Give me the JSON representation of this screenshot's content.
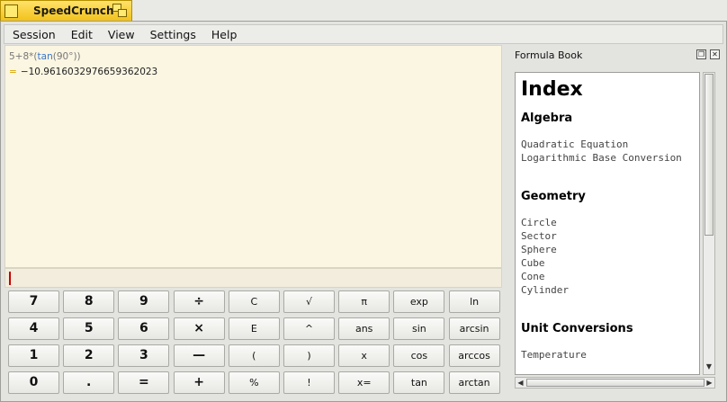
{
  "app": {
    "title": "SpeedCrunch"
  },
  "menubar": [
    "Session",
    "Edit",
    "View",
    "Settings",
    "Help"
  ],
  "display": {
    "expression": {
      "prefix": "5+8*(",
      "fn": "tan",
      "suffix": "(90°))"
    },
    "result_eq": "=",
    "result_value": "−10.9616032976659362023"
  },
  "input": {
    "value": ""
  },
  "keypad": [
    [
      "7",
      "8",
      "9",
      "÷",
      "C",
      "√",
      "π",
      "exp",
      "ln"
    ],
    [
      "4",
      "5",
      "6",
      "×",
      "E",
      "^",
      "ans",
      "sin",
      "arcsin"
    ],
    [
      "1",
      "2",
      "3",
      "—",
      "(",
      ")",
      "x",
      "cos",
      "arccos"
    ],
    [
      "0",
      ".",
      "=",
      "+",
      "%",
      "!",
      "x=",
      "tan",
      "arctan"
    ]
  ],
  "formula_book": {
    "title": "Formula Book",
    "heading": "Index",
    "sections": [
      {
        "name": "Algebra",
        "items": [
          "Quadratic Equation",
          "Logarithmic Base Conversion"
        ]
      },
      {
        "name": "Geometry",
        "items": [
          "Circle",
          "Sector",
          "Sphere",
          "Cube",
          "Cone",
          "Cylinder"
        ]
      },
      {
        "name": "Unit Conversions",
        "items": [
          "Temperature"
        ]
      }
    ]
  }
}
